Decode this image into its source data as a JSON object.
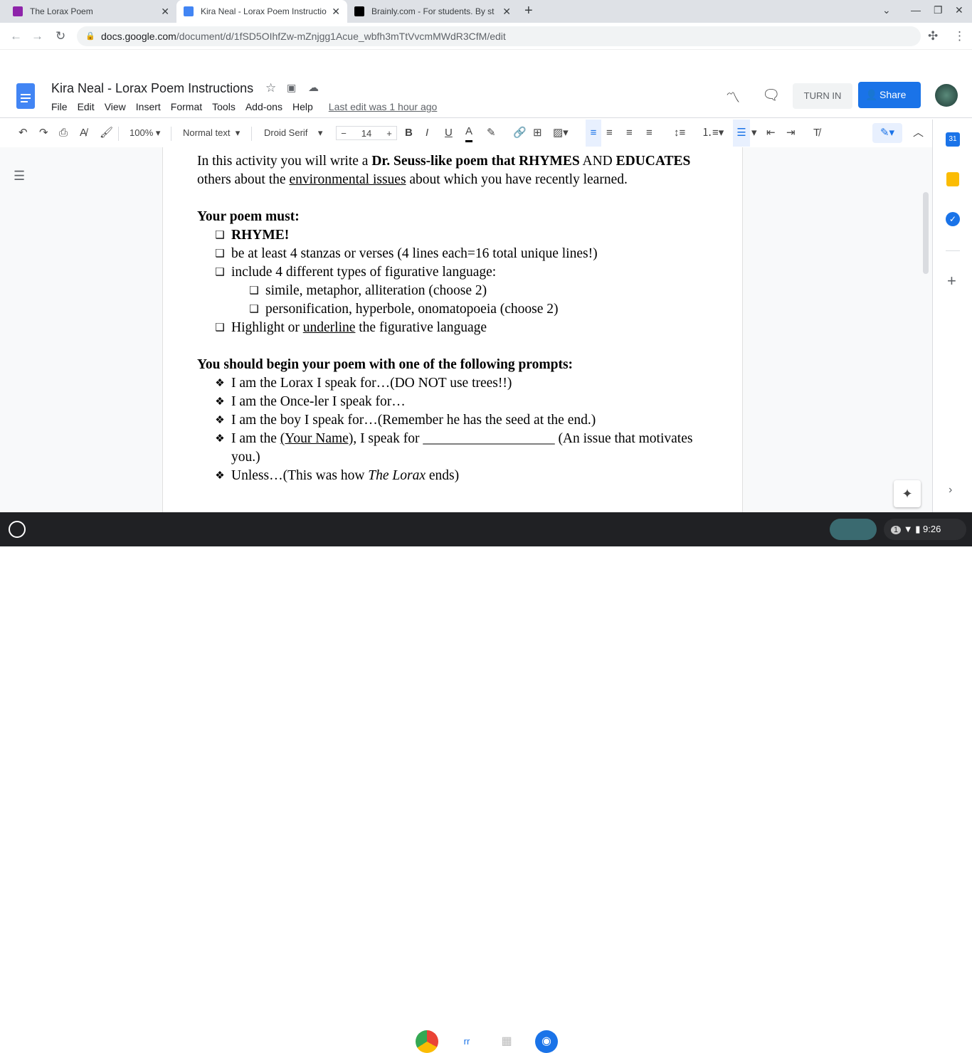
{
  "browser": {
    "tabs": [
      {
        "title": "The Lorax Poem",
        "active": false,
        "color": "#8e24aa"
      },
      {
        "title": "Kira Neal - Lorax Poem Instructio",
        "active": true,
        "color": "#4285f4"
      },
      {
        "title": "Brainly.com - For students. By st",
        "active": false,
        "color": "#000000"
      }
    ],
    "url_host": "docs.google.com",
    "url_path": "/document/d/1fSD5OIhfZw-mZnjgg1Acue_wbfh3mTtVvcmMWdR3CfM/edit"
  },
  "docs": {
    "title": "Kira Neal - Lorax Poem Instructions",
    "menus": [
      "File",
      "Edit",
      "View",
      "Insert",
      "Format",
      "Tools",
      "Add-ons",
      "Help"
    ],
    "last_edit": "Last edit was 1 hour ago",
    "turn_in": "TURN IN",
    "share": "Share",
    "toolbar": {
      "zoom": "100%",
      "style": "Normal text",
      "font": "Droid Serif",
      "size": "14"
    }
  },
  "content": {
    "intro": [
      "In this activity you will write a ",
      "Dr. Seuss-like poem that RHYMES",
      " AND ",
      "EDUCATES",
      " others about the ",
      "environmental issues",
      " about which you have recently learned."
    ],
    "must_heading": "Your poem must:",
    "must": [
      "RHYME!",
      "be at least 4 stanzas or verses (4 lines each=16 total unique lines!)",
      "include 4 different types of figurative language:"
    ],
    "must_sub": [
      "simile, metaphor, alliteration  (choose 2)",
      "personification, hyperbole, onomatopoeia (choose 2)"
    ],
    "highlight": [
      "Highlight or ",
      "underline",
      " the figurative language"
    ],
    "prompts_heading": "You should begin your poem with one of the following prompts:",
    "prompts": [
      "I am the Lorax I speak for…(DO NOT use trees!!)",
      "I am the Once-ler I speak for…",
      "I am the boy I speak for…(Remember he has the seed at the end.)"
    ],
    "prompt4": [
      "I am the ",
      "(Your Name),",
      " I speak for ___________________ (An issue that motivates you.)"
    ],
    "prompt5": [
      "Unless…(This was how ",
      "The Lorax",
      " ends)"
    ]
  },
  "shelf": {
    "time": "9:26",
    "notifications": "1"
  }
}
